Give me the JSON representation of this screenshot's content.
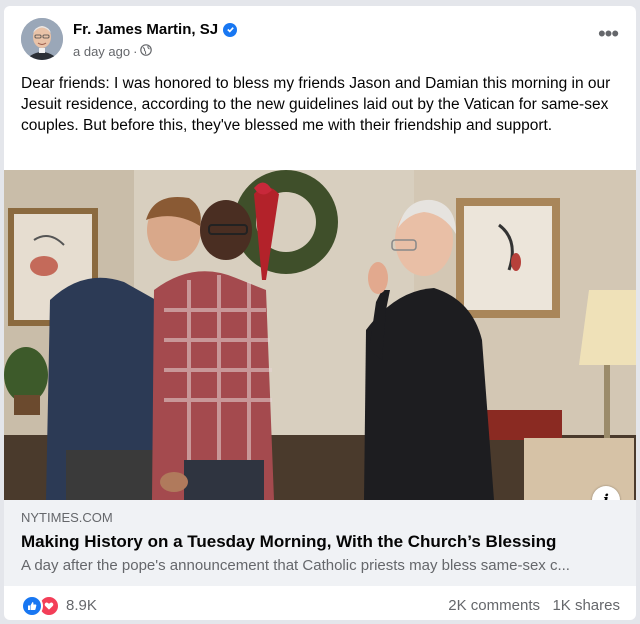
{
  "post": {
    "author": "Fr. James Martin, SJ",
    "timestamp": "a day ago",
    "separator": "·",
    "privacy_icon": "globe-icon",
    "verified_icon": "verified-badge-icon",
    "more_label": "•••",
    "text": "Dear friends: I was honored to bless my friends Jason and Damian this morning in our Jesuit residence, according to the new guidelines laid out by the Vatican for same-sex couples. But before this, they've blessed me with their friendship and support."
  },
  "image": {
    "info_label": "i",
    "info_icon": "info-icon"
  },
  "link_preview": {
    "domain": "NYTIMES.COM",
    "title": "Making History on a Tuesday Morning, With the Church’s Blessing",
    "description": "A day after the pope's announcement that Catholic priests may bless same-sex c..."
  },
  "engagement": {
    "reactions": [
      "like-icon",
      "love-icon"
    ],
    "reaction_count": "8.9K",
    "comments": "2K comments",
    "shares": "1K shares"
  },
  "colors": {
    "accent": "#1877f2",
    "love": "#f33e58",
    "secondary_text": "#65676b",
    "link_bg": "#f0f2f5"
  }
}
